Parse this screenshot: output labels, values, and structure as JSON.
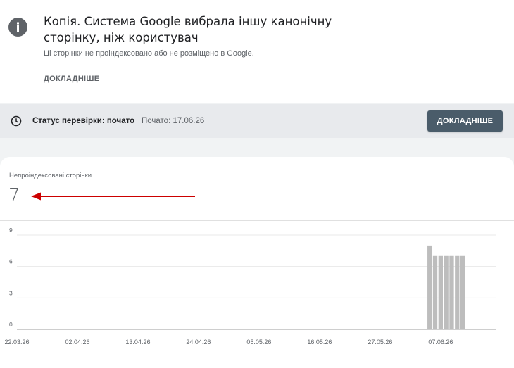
{
  "notice": {
    "icon": "info-icon",
    "title": "Копія. Система Google вибрала іншу канонічну сторінку, ніж користувач",
    "subtitle": "Ці сторінки не проіндексовано або не розміщено в Google.",
    "learn_more": "ДОКЛАДНІШЕ"
  },
  "validation": {
    "icon": "clock-icon",
    "status_label": "Статус перевірки: почато",
    "started": "Почато: 17.06.26",
    "details_button": "ДОКЛАДНІШЕ"
  },
  "summary": {
    "label": "Непроіндексовані сторінки",
    "value": "7",
    "annotation_arrow_color": "#cc0000"
  },
  "chart_data": {
    "type": "bar",
    "title": "",
    "xlabel": "",
    "ylabel": "",
    "ylim": [
      0,
      9
    ],
    "y_ticks": [
      "0",
      "3",
      "6",
      "9"
    ],
    "x_tick_labels": [
      "22.03.26",
      "02.04.26",
      "13.04.26",
      "24.04.26",
      "05.05.26",
      "16.05.26",
      "27.05.26",
      "07.06.26"
    ],
    "x_range": [
      "22.03.26",
      "17.06.26"
    ],
    "categories": [
      "05.06.26",
      "06.06.26",
      "07.06.26",
      "08.06.26",
      "09.06.26",
      "10.06.26",
      "11.06.26"
    ],
    "values": [
      8,
      7,
      7,
      7,
      7,
      7,
      7
    ],
    "bar_color": "#bdbdbd",
    "grid": true
  }
}
